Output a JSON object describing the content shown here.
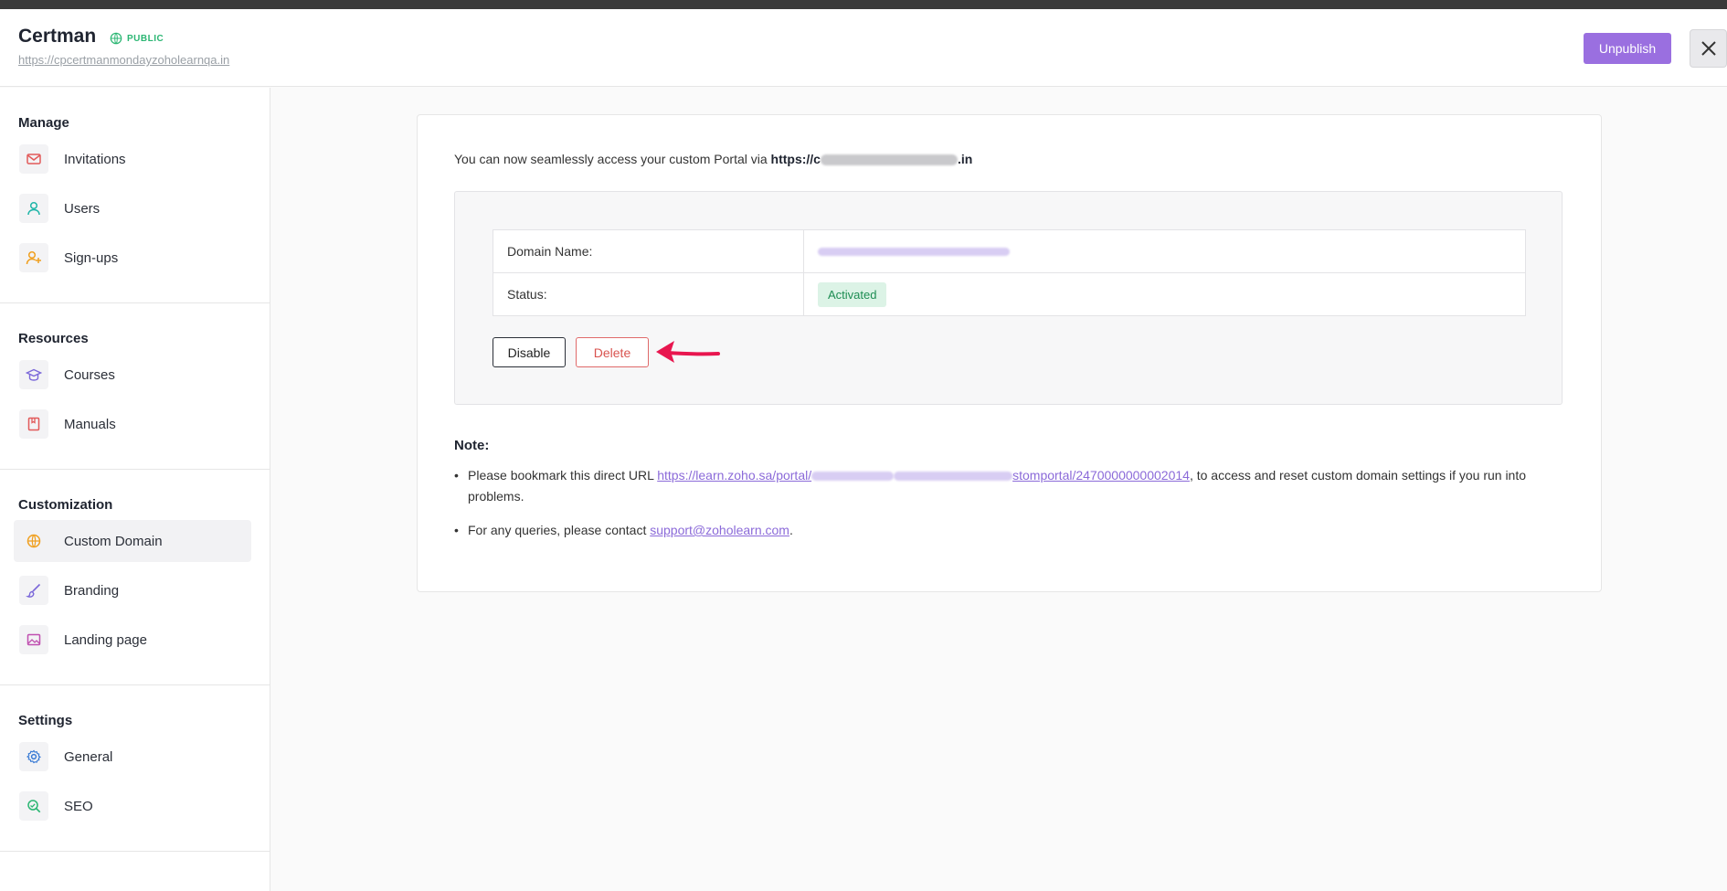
{
  "header": {
    "title": "Certman",
    "visibility": "PUBLIC",
    "portal_url": "https://cpcertmanmondayzoholearnqa.in",
    "unpublish_label": "Unpublish",
    "close_label": "×"
  },
  "sidebar": {
    "sections": [
      {
        "title": "Manage",
        "items": [
          {
            "label": "Invitations",
            "icon": "mail-icon"
          },
          {
            "label": "Users",
            "icon": "user-icon"
          },
          {
            "label": "Sign-ups",
            "icon": "user-add-icon"
          }
        ]
      },
      {
        "title": "Resources",
        "items": [
          {
            "label": "Courses",
            "icon": "graduation-cap-icon"
          },
          {
            "label": "Manuals",
            "icon": "book-icon"
          }
        ]
      },
      {
        "title": "Customization",
        "items": [
          {
            "label": "Custom Domain",
            "icon": "globe-icon",
            "active": true
          },
          {
            "label": "Branding",
            "icon": "brush-icon"
          },
          {
            "label": "Landing page",
            "icon": "image-icon"
          }
        ]
      },
      {
        "title": "Settings",
        "items": [
          {
            "label": "General",
            "icon": "gear-icon"
          },
          {
            "label": "SEO",
            "icon": "seo-search-icon"
          }
        ]
      }
    ]
  },
  "main": {
    "intro_text": "You can now seamlessly access your custom Portal via ",
    "intro_url_prefix": "https://c",
    "intro_url_suffix": ".in",
    "domain_label": "Domain Name:",
    "status_label": "Status:",
    "status_value": "Activated",
    "disable_label": "Disable",
    "delete_label": "Delete",
    "note_title": "Note:",
    "note1_prefix": "Please bookmark this direct URL ",
    "note1_link_start": "https://learn.zoho.sa/portal/",
    "note1_link_end": "stomportal/2470000000002014",
    "note1_suffix": ", to access and reset custom domain settings if you run into problems.",
    "note2_prefix": "For any queries, please contact ",
    "note2_link": "support@zoholearn.com",
    "note2_suffix": "."
  },
  "colors": {
    "accent": "#9a6fe0",
    "status_green": "#1e8d53",
    "delete_red": "#d9534f",
    "arrow": "#e8164f"
  }
}
